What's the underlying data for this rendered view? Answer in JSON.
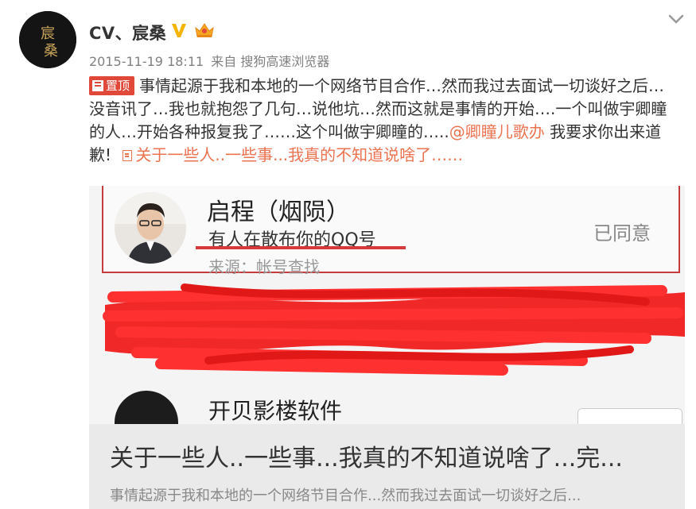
{
  "header": {
    "avatar_text": "宸桑",
    "username": "CV、宸桑",
    "verified_icon": "verified-v-icon",
    "member_icon": "crown-icon",
    "menu_icon": "chevron-down-icon",
    "time": "2015-11-19 18:11",
    "source": "来自 搜狗高速浏览器"
  },
  "post": {
    "pin_label": "置顶",
    "text_before_mention": "事情起源于我和本地的一个网络节目合作…然而我过去面试一切谈好之后…没音讯了…我也就抱怨了几句…说他坑…然而这就是事情的开始….一个叫做宇卿瞳的人…开始各种报复我了……这个叫做宇卿瞳的…..",
    "mention": "@卿瞳儿歌办",
    "text_after_mention": " 我要求你出来道歉! ",
    "article_link": "关于一些人..一些事...我真的不知道说啥了……"
  },
  "card": {
    "screenshot": {
      "name": "启程（烟陨）",
      "message": "有人在散布你的QQ号",
      "source": "来源：帐号查找",
      "status": "已同意",
      "bottom_name": "开贝影楼软件"
    },
    "title": "关于一些人..一些事...我真的不知道说啥了...完...",
    "summary": "事情起源于我和本地的一个网络节目合作...然而我过去面试一切谈好之后..."
  },
  "colors": {
    "link": "#eb7350",
    "pin": "#e0483a",
    "vip": "#f5a623"
  }
}
